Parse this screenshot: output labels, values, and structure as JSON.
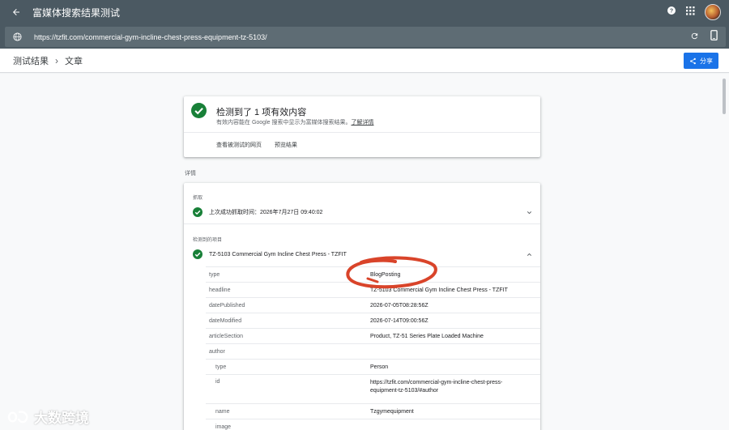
{
  "window": {
    "title": "富媒体搜索结果测试",
    "url": "https://tzfit.com/commercial-gym-incline-chest-press-equipment-tz-5103/"
  },
  "header": {
    "breadcrumb_root": "测试结果",
    "breadcrumb_current": "文章",
    "share_label": "分享"
  },
  "summary": {
    "heading": "检测到了 1 项有效内容",
    "subtext": "有效内容能在 Google 搜索中显示为富媒体搜索结果。",
    "learn_more": "了解详情",
    "view_tested_page": "查看被测试的网页",
    "preview_results": "预览结果"
  },
  "details": {
    "label": "详情",
    "crawl_label": "抓取",
    "crawl_status": "上次成功抓取时间：2026年7月27日 09:40:02",
    "detected_label": "检测到的项目",
    "item_title": "TZ-5103 Commercial Gym Incline Chest Press - TZFIT",
    "properties": [
      {
        "key": "type",
        "value": "BlogPosting"
      },
      {
        "key": "headline",
        "value": "TZ-5103 Commercial Gym Incline Chest Press - TZFIT"
      },
      {
        "key": "datePublished",
        "value": "2026-07-05T08:28:56Z"
      },
      {
        "key": "dateModified",
        "value": "2026-07-14T09:00:56Z"
      },
      {
        "key": "articleSection",
        "value": "Product, TZ-51 Series Plate Loaded Machine"
      },
      {
        "key": "author",
        "value": ""
      }
    ],
    "author_properties": [
      {
        "key": "type",
        "value": "Person"
      },
      {
        "key": "id",
        "value": "https://tzfit.com/commercial-gym-incline-chest-press-equipment-tz-5103/#author"
      },
      {
        "key": "name",
        "value": "Tzgymequipment"
      },
      {
        "key": "image",
        "value": ""
      }
    ]
  },
  "watermark": "大数跨境",
  "colors": {
    "chrome": "#4b5962",
    "accent": "#1a73e8",
    "success": "#188038",
    "annotation": "#d9442a"
  }
}
